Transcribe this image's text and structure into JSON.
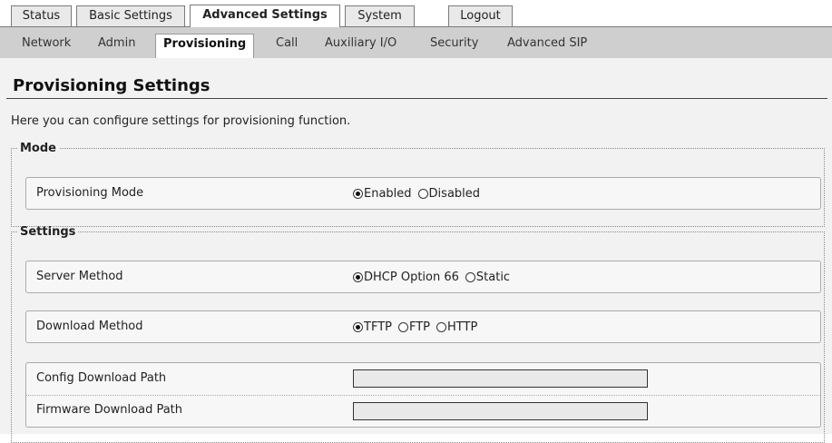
{
  "top_tabs": [
    {
      "label": "Status",
      "active": false
    },
    {
      "label": "Basic Settings",
      "active": false
    },
    {
      "label": "Advanced Settings",
      "active": true
    },
    {
      "label": "System",
      "active": false
    },
    {
      "label": "Logout",
      "active": false
    }
  ],
  "sub_tabs": [
    {
      "label": "Network",
      "active": false
    },
    {
      "label": "Admin",
      "active": false
    },
    {
      "label": "Provisioning",
      "active": true
    },
    {
      "label": "Call",
      "active": false
    },
    {
      "label": "Auxiliary I/O",
      "active": false
    },
    {
      "label": "Security",
      "active": false
    },
    {
      "label": "Advanced SIP",
      "active": false
    }
  ],
  "page": {
    "title": "Provisioning Settings",
    "intro": "Here you can configure settings for provisioning function."
  },
  "mode_group": {
    "legend": "Mode",
    "provisioning_mode": {
      "label": "Provisioning Mode",
      "options": [
        "Enabled",
        "Disabled"
      ],
      "selected": "Enabled"
    }
  },
  "settings_group": {
    "legend": "Settings",
    "server_method": {
      "label": "Server Method",
      "options": [
        "DHCP Option 66",
        "Static"
      ],
      "selected": "DHCP Option 66"
    },
    "download_method": {
      "label": "Download Method",
      "options": [
        "TFTP",
        "FTP",
        "HTTP"
      ],
      "selected": "TFTP"
    },
    "config_download_path": {
      "label": "Config Download Path",
      "value": ""
    },
    "firmware_download_path": {
      "label": "Firmware Download Path",
      "value": ""
    }
  },
  "colors": {
    "tab_bar": "#cfcfcf",
    "content_bg": "#f2f2f2",
    "input_bg": "#e9e9e9"
  }
}
